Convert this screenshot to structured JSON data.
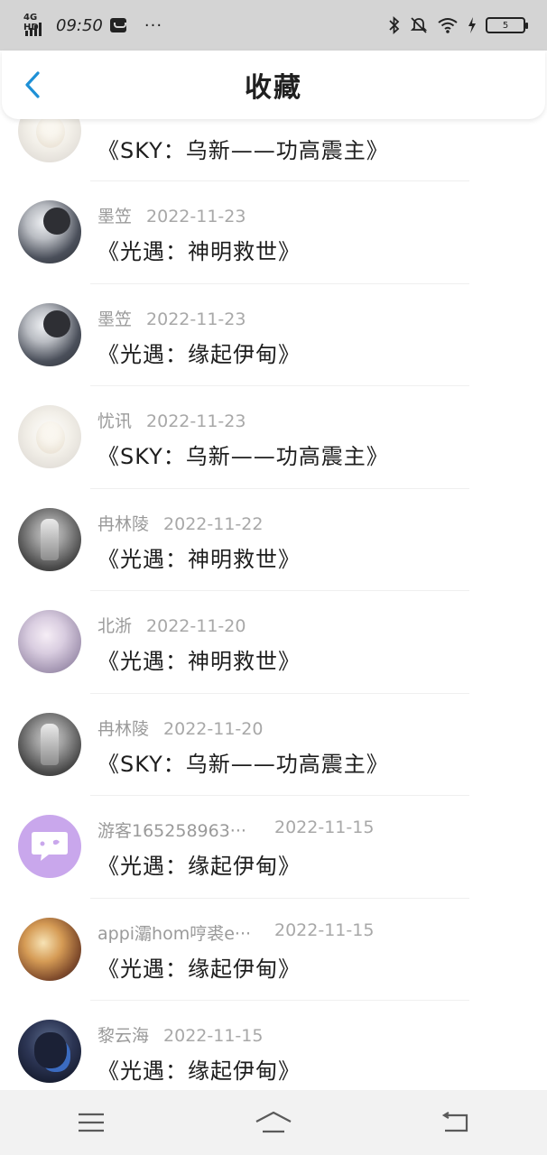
{
  "status_bar": {
    "network": "4G HD",
    "time": "09:50",
    "more": "···",
    "battery": "5"
  },
  "header": {
    "title": "收藏"
  },
  "favorites": [
    {
      "user": "",
      "date": "",
      "title": "《SKY：乌新——功高震主》",
      "avatar": "white"
    },
    {
      "user": "墨笠",
      "date": "2022-11-23",
      "title": "《光遇：神明救世》",
      "avatar": "dark"
    },
    {
      "user": "墨笠",
      "date": "2022-11-23",
      "title": "《光遇：缘起伊甸》",
      "avatar": "dark"
    },
    {
      "user": "忧讯",
      "date": "2022-11-23",
      "title": "《SKY：乌新——功高震主》",
      "avatar": "white"
    },
    {
      "user": "冉林陵",
      "date": "2022-11-22",
      "title": "《光遇：神明救世》",
      "avatar": "statue"
    },
    {
      "user": "北浙",
      "date": "2022-11-20",
      "title": "《光遇：神明救世》",
      "avatar": "purple"
    },
    {
      "user": "冉林陵",
      "date": "2022-11-20",
      "title": "《SKY：乌新——功高震主》",
      "avatar": "statue"
    },
    {
      "user": "游客165258963···",
      "date": "2022-11-15",
      "title": "《光遇：缘起伊甸》",
      "avatar": "chat"
    },
    {
      "user": "appi灞hom哼裘e···",
      "date": "2022-11-15",
      "title": "《光遇：缘起伊甸》",
      "avatar": "food"
    },
    {
      "user": "黎云海",
      "date": "2022-11-15",
      "title": "《光遇：缘起伊甸》",
      "avatar": "anime"
    }
  ],
  "nav": {
    "menu_icon": "menu-icon",
    "home_icon": "home-icon",
    "back_icon": "return-icon"
  },
  "colors": {
    "accent": "#1e90d6",
    "status_bar_bg": "#d4d4d4",
    "nav_bg": "#f2f2f2",
    "meta_text": "#9a9a9a"
  }
}
